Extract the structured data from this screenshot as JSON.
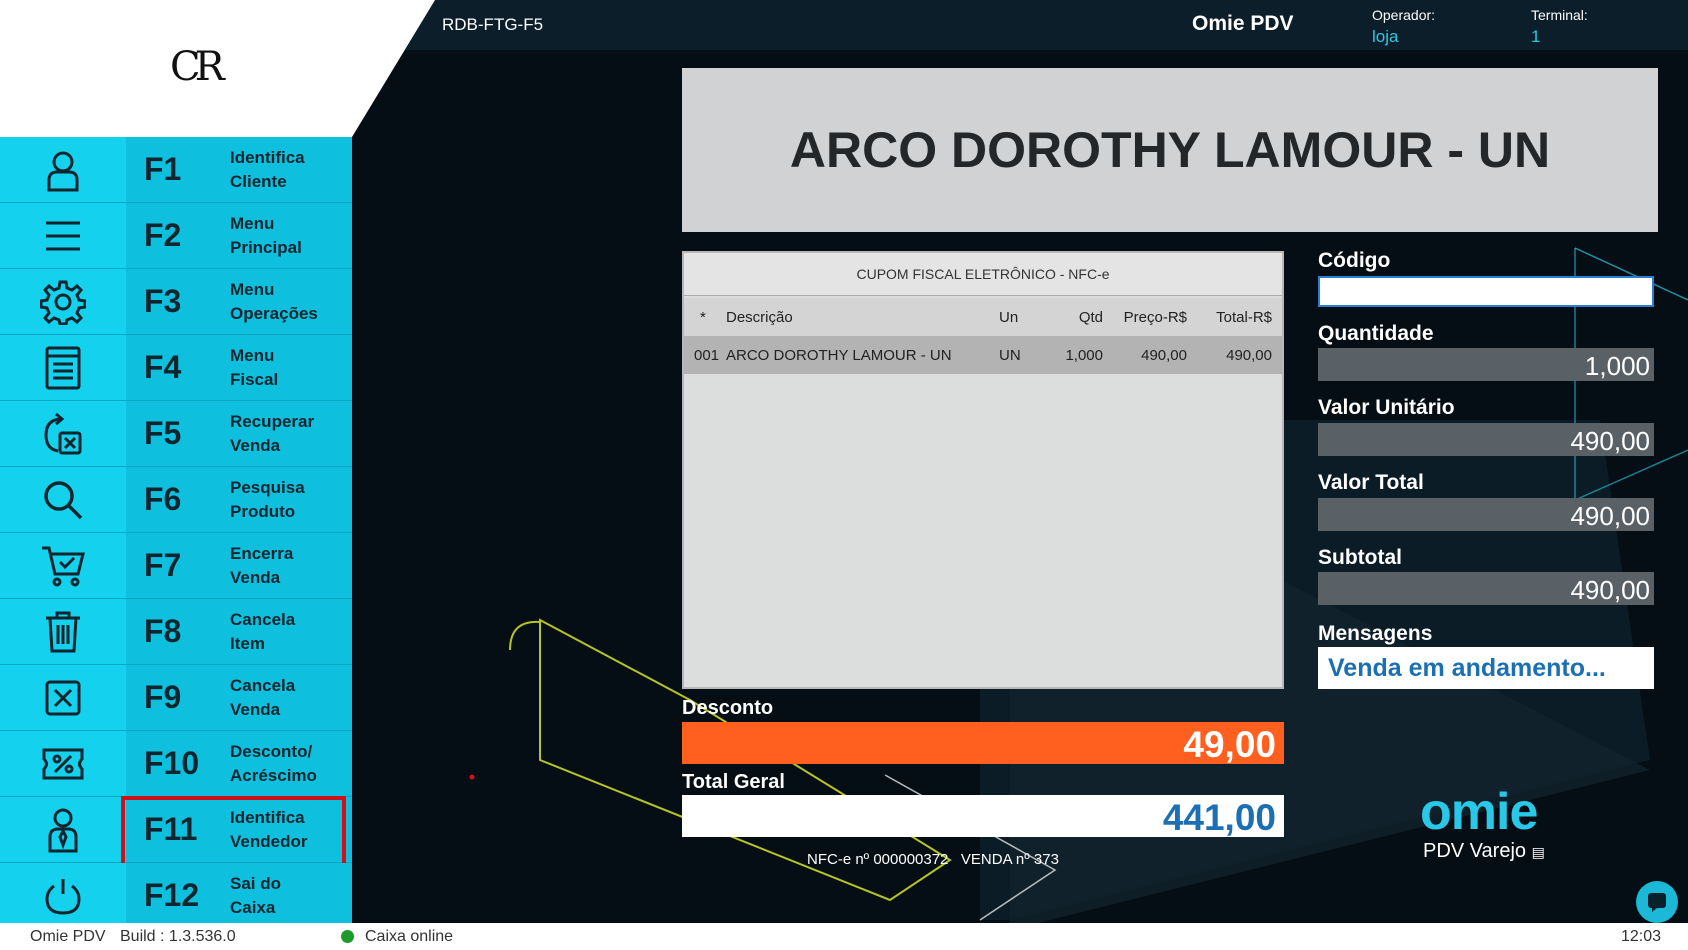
{
  "header": {
    "store_code": "RDB-FTG-F5",
    "app_title": "Omie PDV",
    "operator_label": "Operador:",
    "operator_value": "loja",
    "terminal_label": "Terminal:",
    "terminal_value": "1",
    "logo_text": "CR"
  },
  "sidebar": {
    "items": [
      {
        "key": "F1",
        "line1": "Identifica",
        "line2": "Cliente",
        "icon": "user-icon"
      },
      {
        "key": "F2",
        "line1": "Menu",
        "line2": "Principal",
        "icon": "menu-icon"
      },
      {
        "key": "F3",
        "line1": "Menu",
        "line2": "Operações",
        "icon": "gear-icon"
      },
      {
        "key": "F4",
        "line1": "Menu",
        "line2": "Fiscal",
        "icon": "receipt-icon"
      },
      {
        "key": "F5",
        "line1": "Recuperar",
        "line2": "Venda",
        "icon": "recover-icon"
      },
      {
        "key": "F6",
        "line1": "Pesquisa",
        "line2": "Produto",
        "icon": "search-icon"
      },
      {
        "key": "F7",
        "line1": "Encerra",
        "line2": "Venda",
        "icon": "cart-icon"
      },
      {
        "key": "F8",
        "line1": "Cancela",
        "line2": "Item",
        "icon": "trash-icon"
      },
      {
        "key": "F9",
        "line1": "Cancela",
        "line2": "Venda",
        "icon": "cancel-box-icon"
      },
      {
        "key": "F10",
        "line1": "Desconto/",
        "line2": "Acréscimo",
        "icon": "percent-icon"
      },
      {
        "key": "F11",
        "line1": "Identifica",
        "line2": "Vendedor",
        "icon": "seller-icon"
      },
      {
        "key": "F12",
        "line1": "Sai do",
        "line2": "Caixa",
        "icon": "power-icon"
      }
    ],
    "highlighted": "F11"
  },
  "product_banner": "ARCO DOROTHY LAMOUR - UN",
  "receipt": {
    "title": "CUPOM FISCAL ELETRÔNICO - NFC-e",
    "columns": [
      "*",
      "Descrição",
      "Un",
      "Qtd",
      "Preço-R$",
      "Total-R$"
    ],
    "rows": [
      [
        "001",
        "ARCO DOROTHY LAMOUR - UN",
        "UN",
        "1,000",
        "490,00",
        "490,00"
      ]
    ]
  },
  "totals": {
    "desconto_label": "Desconto",
    "desconto_value": "49,00",
    "total_label": "Total Geral",
    "total_value": "441,00",
    "nfc_info": "NFC-e nº 000000372   VENDA nº 373"
  },
  "form": {
    "codigo_label": "Código",
    "codigo_value": "",
    "quantidade_label": "Quantidade",
    "quantidade_value": "1,000",
    "valor_unitario_label": "Valor Unitário",
    "valor_unitario_value": "490,00",
    "valor_total_label": "Valor Total",
    "valor_total_value": "490,00",
    "subtotal_label": "Subtotal",
    "subtotal_value": "490,00",
    "mensagens_label": "Mensagens",
    "mensagens_value": "Venda em andamento..."
  },
  "brand": {
    "logo": "omie",
    "subtitle": "PDV Varejo"
  },
  "statusbar": {
    "app": "Omie PDV",
    "build": "Build : 1.3.536.0",
    "status": "Caixa online",
    "time": "12:03"
  },
  "colors": {
    "accent": "#14d2ee",
    "discount": "#ff5f1f",
    "total_text": "#1b6fb3",
    "highlight_border": "#d0111a",
    "online": "#1c9a2a"
  }
}
